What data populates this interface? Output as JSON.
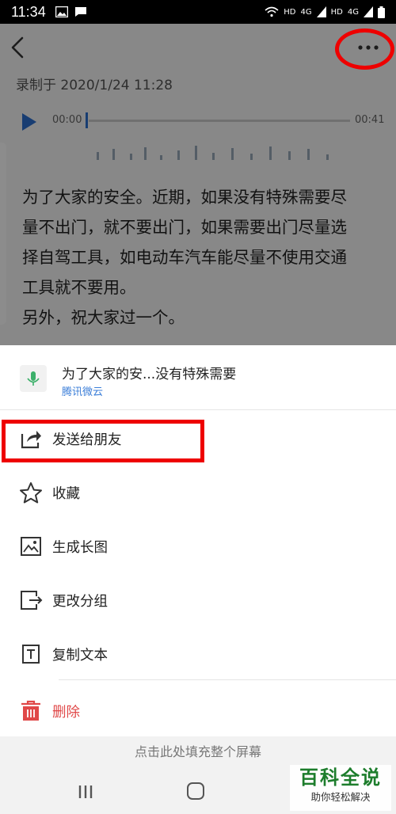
{
  "status_bar": {
    "time": "11:34",
    "right_labels": [
      "HD",
      "4G",
      "HD",
      "4G"
    ]
  },
  "note": {
    "record_label": "录制于 2020/1/24 11:28",
    "audio_start": "00:00",
    "audio_end": "00:41",
    "audio_progress": 0,
    "text_lines": [
      "为了大家的安全。近期，如果没有特殊需要尽",
      "量不出门，就不要出门，如果需要出门尽量选",
      "择自驾工具，如电动车汽车能尽量不使用交通",
      "工具就不要用。",
      "另外，祝大家过一个。"
    ]
  },
  "share_sheet": {
    "title": "为了大家的安...没有特殊需要",
    "source": "腾讯微云",
    "items": [
      {
        "label": "发送给朋友",
        "icon": "share-icon"
      },
      {
        "label": "收藏",
        "icon": "star-icon"
      },
      {
        "label": "生成长图",
        "icon": "image-icon"
      },
      {
        "label": "更改分组",
        "icon": "move-group-icon"
      },
      {
        "label": "复制文本",
        "icon": "text-icon"
      },
      {
        "label": "删除",
        "icon": "trash-icon"
      }
    ],
    "fill_screen": "点击此处填充整个屏幕"
  },
  "watermark": {
    "title": "百科全说",
    "subtitle": "助你轻松解决"
  },
  "colors": {
    "accent_blue": "#2d6fcf",
    "source_blue": "#3b7ed8",
    "danger_red": "#e04848",
    "annotation_red": "#ee0000",
    "watermark_green": "#1d7d2c"
  }
}
